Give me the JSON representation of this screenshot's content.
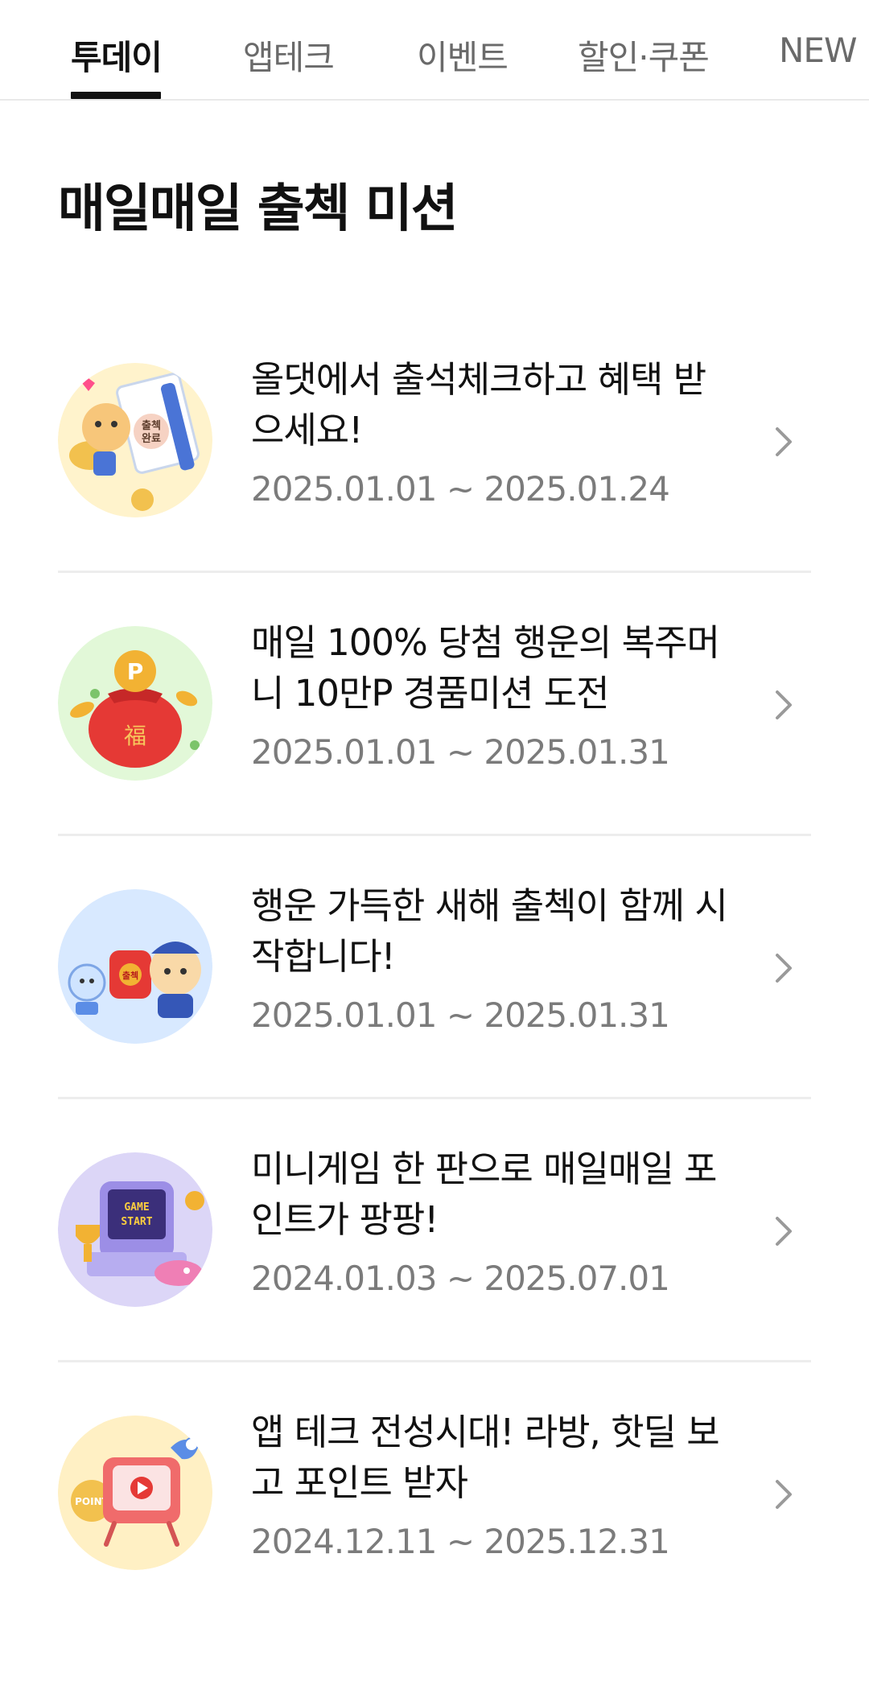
{
  "tabs": [
    {
      "label": "투데이",
      "active": true
    },
    {
      "label": "앱테크",
      "active": false
    },
    {
      "label": "이벤트",
      "active": false
    },
    {
      "label": "할인·쿠폰",
      "active": false
    },
    {
      "label": "NEW",
      "active": false
    }
  ],
  "page_title": "매일매일 출첵 미션",
  "missions": [
    {
      "title": "올댓에서 출석체크하고 혜택 받으세요!",
      "period": "2025.01.01 ~ 2025.01.24",
      "thumb_bg": "#fff3cc",
      "thumb_icon": "attendance-calendar-icon",
      "thumb_text": "출첵완료"
    },
    {
      "title": "매일 100% 당첨 행운의 복주머니 10만P 경품미션 도전",
      "period": "2025.01.01 ~ 2025.01.31",
      "thumb_bg": "#e2f8d8",
      "thumb_icon": "lucky-pouch-icon",
      "thumb_text": "福"
    },
    {
      "title": "행운 가득한 새해 출첵이 함께 시작합니다!",
      "period": "2025.01.01 ~ 2025.01.31",
      "thumb_bg": "#d8e9ff",
      "thumb_icon": "new-year-characters-icon",
      "thumb_text": "출첵"
    },
    {
      "title": "미니게임 한 판으로 매일매일 포인트가 팡팡!",
      "period": "2024.01.03 ~ 2025.07.01",
      "thumb_bg": "#dcd6f7",
      "thumb_icon": "game-console-icon",
      "thumb_text": "GAME START"
    },
    {
      "title": "앱 테크 전성시대! 라방, 핫딜 보고 포인트 받자",
      "period": "2024.12.11 ~ 2025.12.31",
      "thumb_bg": "#fff0c4",
      "thumb_icon": "retro-tv-icon",
      "thumb_text": "POINT"
    }
  ]
}
